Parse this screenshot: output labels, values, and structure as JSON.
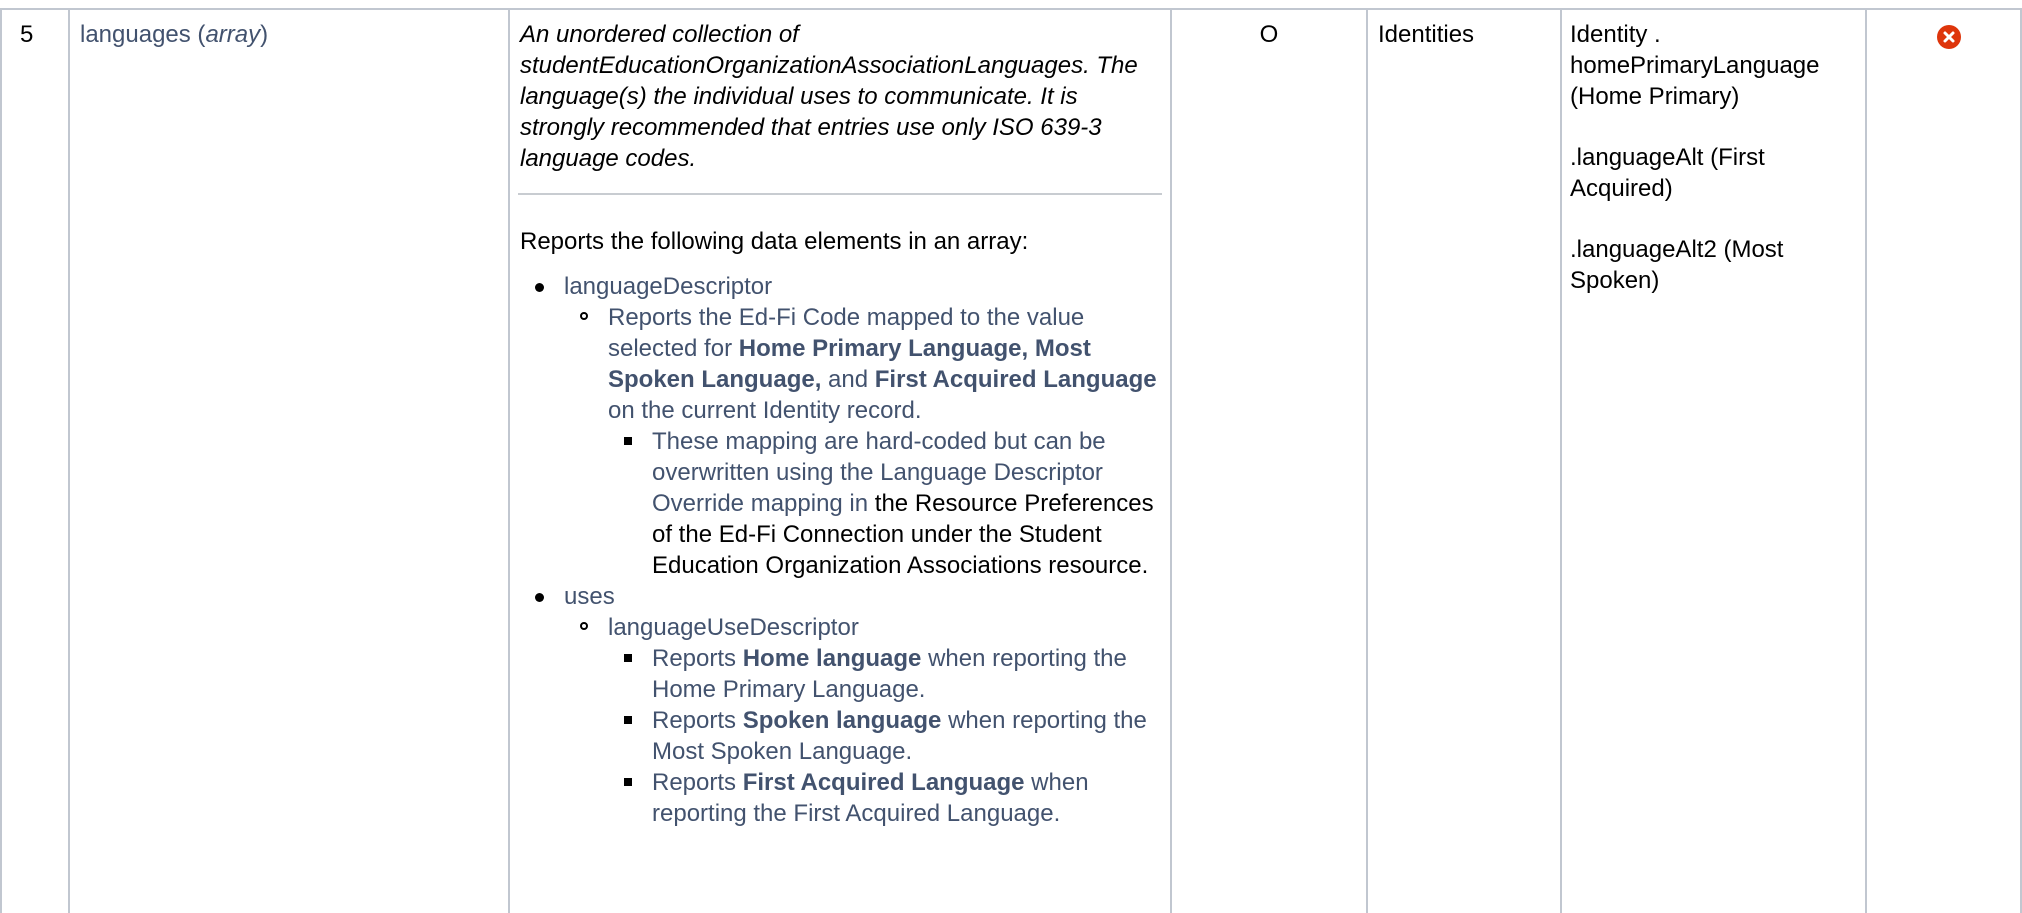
{
  "row": {
    "number": "5",
    "field_name": "languages",
    "field_type": "array",
    "description_italic": "An unordered collection of studentEducationOrganizationAssociationLanguages. The language(s) the individual uses to communicate. It is strongly recommended that entries use only ISO 639-3 language codes.",
    "details_intro": "Reports the following data elements in an array:",
    "language_descriptor": {
      "label": "languageDescriptor",
      "s1": "Reports the Ed-Fi Code mapped to the value selected for ",
      "b1": "Home Primary Language, Most Spoken Language,",
      "s2": " and ",
      "b2": "First Acquired Language",
      "s3": " on the current Identity record.",
      "note_grey": "These mapping are hard-coded but can be overwritten using the Language Descriptor Override mapping in ",
      "note_black": "the Resource Preferences of the Ed-Fi Connection under the Student Education Organization Associations resource."
    },
    "uses": {
      "label": "uses",
      "sub_label": "languageUseDescriptor",
      "items": [
        {
          "pre": "Reports ",
          "bold": "Home language",
          "post": " when reporting the Home Primary Language."
        },
        {
          "pre": "Reports ",
          "bold": "Spoken language",
          "post": " when reporting the Most Spoken Language."
        },
        {
          "pre": "Reports ",
          "bold": "First Acquired Language",
          "post": " when reporting the First Acquired Language."
        }
      ]
    },
    "optionality": "O",
    "tool": "Identities",
    "mapping": {
      "p1": "Identity . homePrimaryLanguage (Home Primary)",
      "p2": ".languageAlt (First Acquired)",
      "p3": ".languageAlt2 (Most Spoken)"
    },
    "status_icon": "error-x-icon",
    "status_color": "#de350b"
  }
}
